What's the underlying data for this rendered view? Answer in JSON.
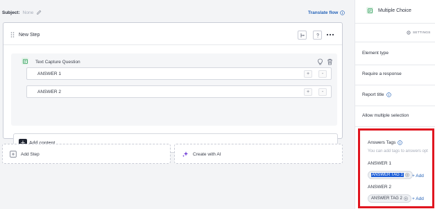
{
  "subject": {
    "label": "Subject:",
    "value": "None"
  },
  "translate_flow": "Translate flow",
  "step": {
    "title": "New Step",
    "question": {
      "title": "Text Capture Question",
      "answers": [
        {
          "label": "ANSWER 1"
        },
        {
          "label": "ANSWER 2"
        }
      ],
      "plus": "+",
      "minus": "-"
    },
    "add_content": "Add content"
  },
  "actions": {
    "add_step": "Add Step",
    "create_ai": "Create with AI"
  },
  "panel": {
    "title": "Multiple Choice",
    "settings_tab": "SETTINGS",
    "rows": [
      "Element type",
      "Require a response",
      "Report title",
      "Allow multiple selection"
    ]
  },
  "answers_tags": {
    "title": "Answers Tags",
    "hint": "You can add tags to answers opt",
    "groups": [
      {
        "answer": "ANSWER 1",
        "tag": "ANSWER TAG 1",
        "add": "+ Add"
      },
      {
        "answer": "ANSWER 2",
        "tag": "ANSWER TAG 2",
        "add": "+ Add"
      }
    ]
  },
  "colors": {
    "accent": "#2563b8",
    "highlight_border": "#e0141e",
    "selection": "#1d5ed8"
  }
}
